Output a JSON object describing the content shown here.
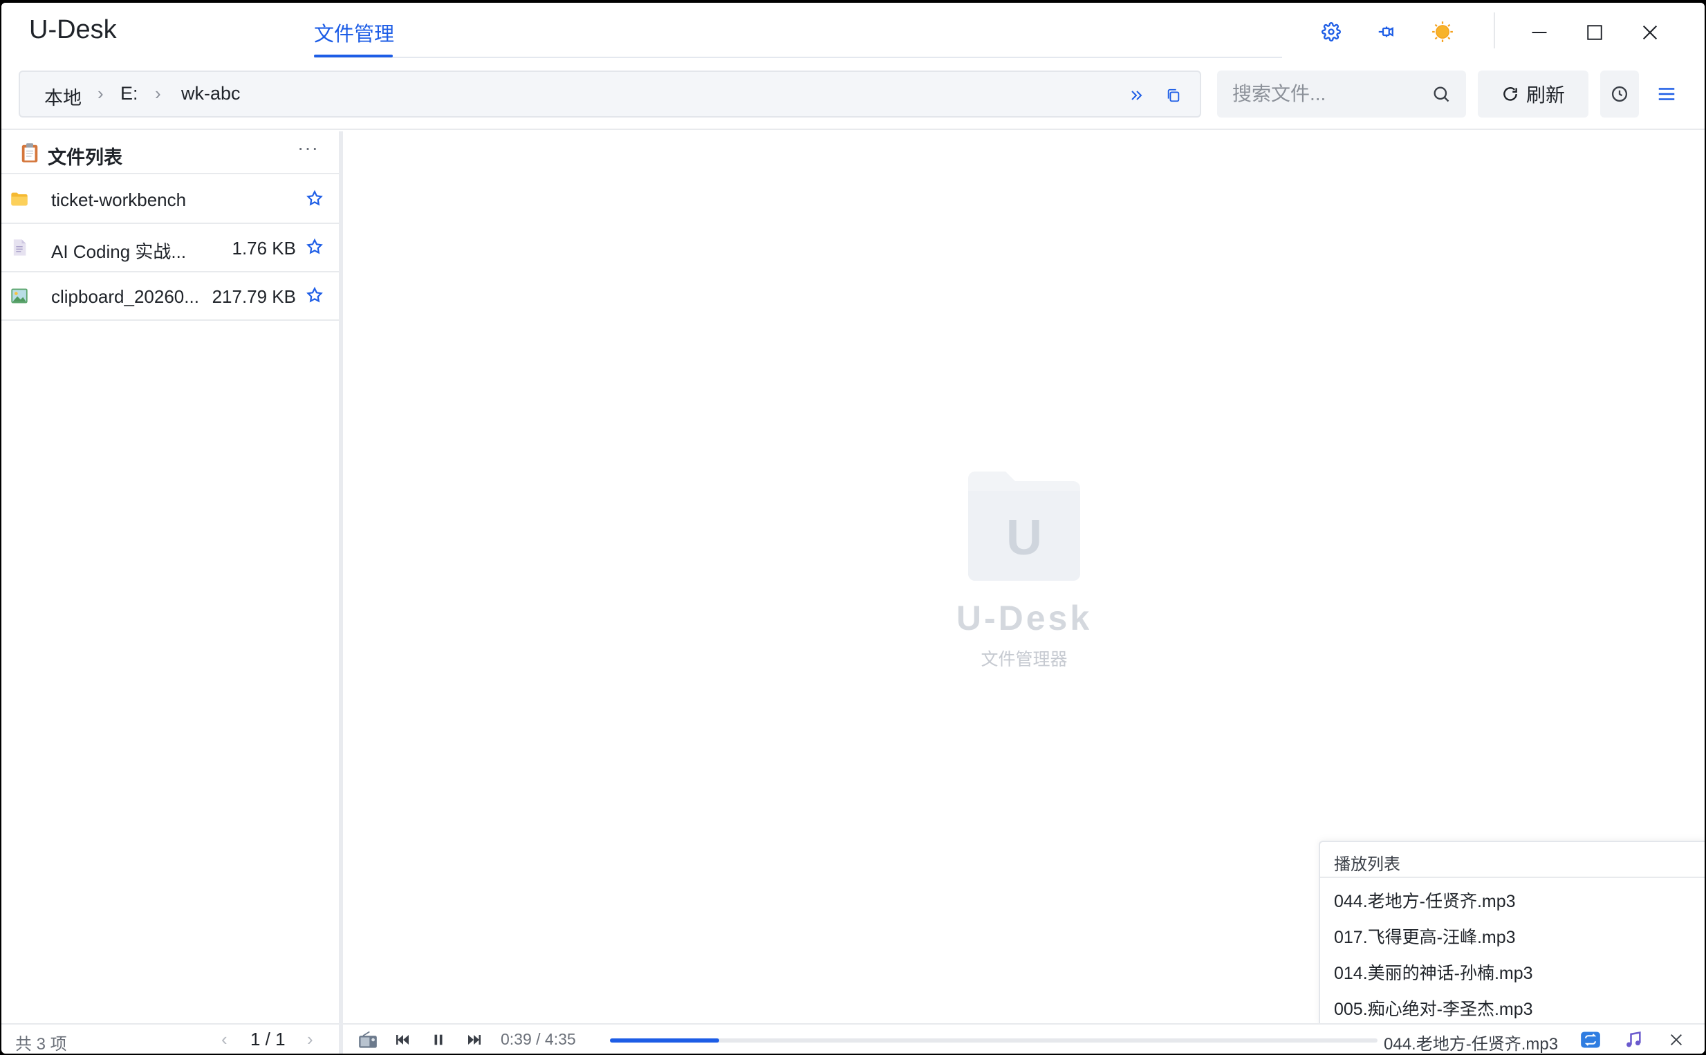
{
  "app": {
    "title": "U-Desk"
  },
  "nav": {
    "tab_label": "文件管理"
  },
  "breadcrumb": {
    "items": [
      "本地",
      "E:",
      "wk-abc"
    ]
  },
  "search": {
    "placeholder": "搜索文件..."
  },
  "toolbar": {
    "refresh_label": "刷新"
  },
  "file_list": {
    "title": "文件列表",
    "more": "···",
    "items": [
      {
        "name": "ticket-workbench",
        "size": "",
        "type": "folder"
      },
      {
        "name": "AI Coding 实战...",
        "size": "1.76 KB",
        "type": "document"
      },
      {
        "name": "clipboard_20260...",
        "size": "217.79 KB",
        "type": "image"
      }
    ],
    "count": "共 3 项",
    "page": "1 / 1"
  },
  "placeholder": {
    "logo_letter": "U",
    "brand": "U-Desk",
    "subtitle": "文件管理器"
  },
  "playlist": {
    "title": "播放列表",
    "items": [
      "044.老地方-任贤齐.mp3",
      "017.飞得更高-汪峰.mp3",
      "014.美丽的神话-孙楠.mp3",
      "005.痴心绝对-李圣杰.mp3"
    ]
  },
  "player": {
    "time": "0:39 / 4:35",
    "progress": 0.142,
    "current_song": "044.老地方-任贤齐.mp3"
  },
  "colors": {
    "accent": "#1d5de6",
    "theme_sun": "#f4a11d"
  }
}
